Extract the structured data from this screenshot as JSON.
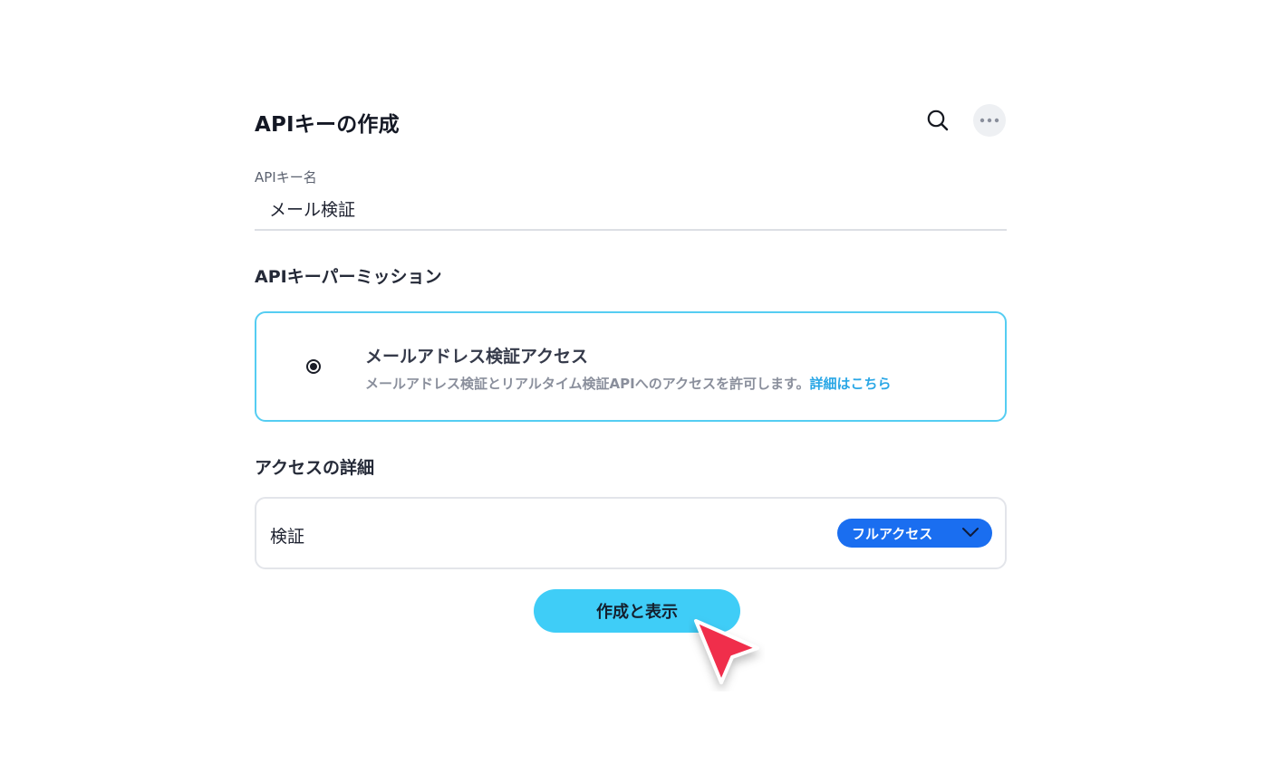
{
  "header": {
    "title": "APIキーの作成",
    "search_icon": "search-icon",
    "more_icon": "more-horizontal-icon"
  },
  "api_key_name": {
    "label": "APIキー名",
    "value": "メール検証"
  },
  "permissions": {
    "section_title": "APIキーパーミッション",
    "option": {
      "name": "メールアドレス検証アクセス",
      "description": "メールアドレス検証とリアルタイム検証APIへのアクセスを許可します。",
      "link_text": "詳細はこちら",
      "selected": true
    }
  },
  "access_details": {
    "section_title": "アクセスの詳細",
    "rows": [
      {
        "label": "検証",
        "selected_value": "フルアクセス"
      }
    ]
  },
  "actions": {
    "submit_label": "作成と表示"
  },
  "colors": {
    "accent_cyan": "#3fcdf7",
    "card_border_selected": "#55cdf2",
    "dropdown_blue": "#1a6ef0",
    "link": "#2aa7e6",
    "cursor_red": "#f02d4b"
  }
}
